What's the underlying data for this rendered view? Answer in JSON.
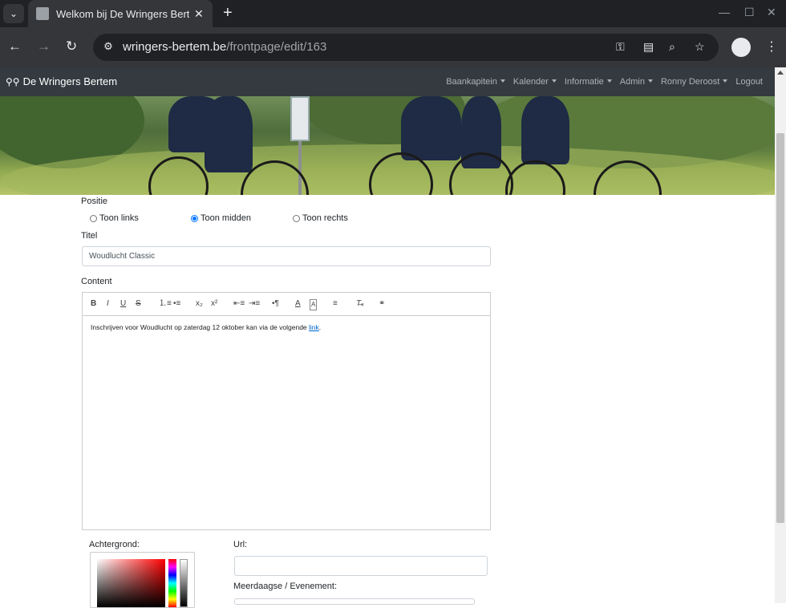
{
  "browser": {
    "tab_title": "Welkom bij De Wringers Bertem",
    "url_host": "wringers-bertem.be",
    "url_path": "/frontpage/edit/163"
  },
  "site": {
    "brand": "De Wringers Bertem",
    "nav": [
      {
        "label": "Baankapitein"
      },
      {
        "label": "Kalender"
      },
      {
        "label": "Informatie"
      },
      {
        "label": "Admin"
      },
      {
        "label": "Ronny Deroost"
      },
      {
        "label": "Logout"
      }
    ]
  },
  "form": {
    "positie_label": "Positie",
    "positions": [
      {
        "label": "Toon links",
        "checked": false
      },
      {
        "label": "Toon midden",
        "checked": true
      },
      {
        "label": "Toon rechts",
        "checked": false
      }
    ],
    "titel_label": "Titel",
    "titel_value": "Woudlucht Classic",
    "content_label": "Content",
    "content_text": "Inschrijven voor Woudlucht op zaterdag 12 oktober kan via de volgende ",
    "content_link": "link",
    "content_after": ".",
    "achtergrond_label": "Achtergrond:",
    "url_label": "Url:",
    "url_value": "",
    "meerdaagse_label": "Meerdaagse / Evenement:"
  },
  "editor_toolbar": [
    {
      "name": "bold-button",
      "glyph": "B"
    },
    {
      "name": "italic-button",
      "glyph": "I"
    },
    {
      "name": "underline-button",
      "glyph": "U"
    },
    {
      "name": "strike-button",
      "glyph": "S"
    },
    {
      "name": "ordered-list-button",
      "glyph": "≡"
    },
    {
      "name": "bullet-list-button",
      "glyph": "☰"
    },
    {
      "name": "subscript-button",
      "glyph": "x₂"
    },
    {
      "name": "superscript-button",
      "glyph": "x²"
    },
    {
      "name": "outdent-button",
      "glyph": "⇤"
    },
    {
      "name": "indent-button",
      "glyph": "⇥"
    },
    {
      "name": "direction-button",
      "glyph": "¶"
    },
    {
      "name": "font-color-button",
      "glyph": "A"
    },
    {
      "name": "background-color-button",
      "glyph": "A"
    },
    {
      "name": "align-button",
      "glyph": "≡"
    },
    {
      "name": "clear-format-button",
      "glyph": "Tx"
    },
    {
      "name": "link-button",
      "glyph": "⛓"
    }
  ]
}
